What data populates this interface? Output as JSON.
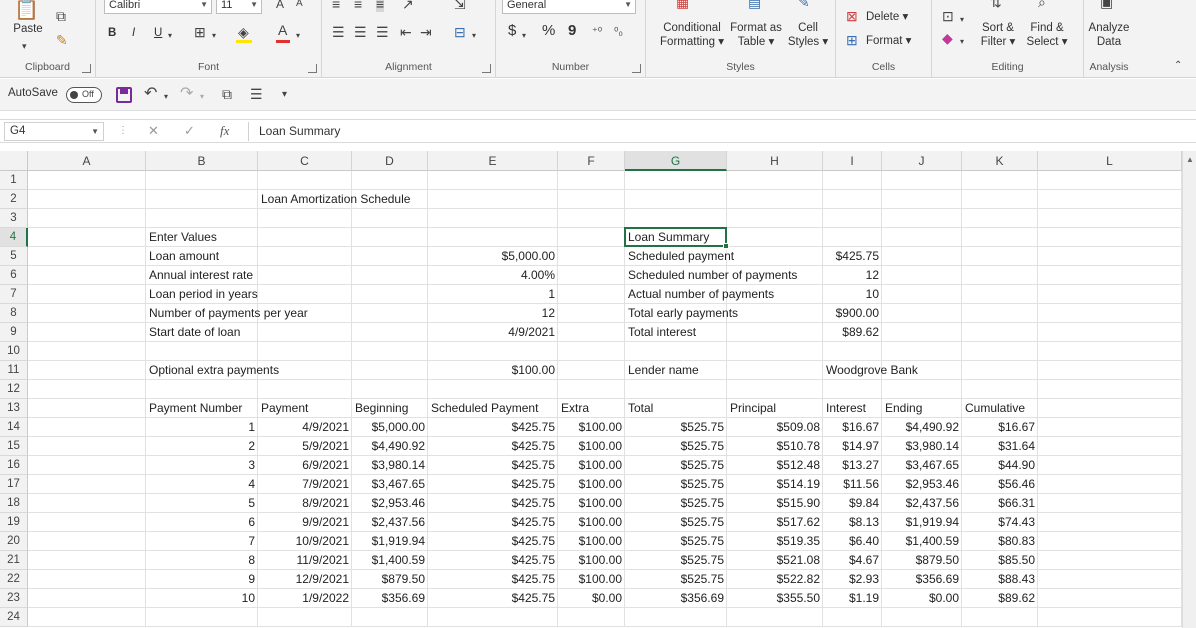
{
  "ribbon": {
    "clipboard": {
      "label": "Clipboard",
      "paste": "Paste"
    },
    "font": {
      "label": "Font",
      "name": "Calibri",
      "size": "11",
      "bold": "B",
      "italic": "I",
      "underline": "U"
    },
    "alignment": {
      "label": "Alignment"
    },
    "number": {
      "label": "Number",
      "format": "General",
      "currency": "$",
      "percent": "%",
      "comma": "9"
    },
    "styles": {
      "label": "Styles",
      "conditional": "Conditional",
      "conditional2": "Formatting",
      "format_table": "Format as",
      "format_table2": "Table",
      "cell_styles": "Cell",
      "cell_styles2": "Styles"
    },
    "cells": {
      "label": "Cells",
      "delete": "Delete",
      "format": "Format"
    },
    "editing": {
      "label": "Editing",
      "sort": "Sort &",
      "sort2": "Filter",
      "find": "Find &",
      "find2": "Select"
    },
    "analysis": {
      "label": "Analysis",
      "analyze": "Analyze",
      "analyze2": "Data"
    }
  },
  "qat": {
    "autosave": "AutoSave",
    "autosave_state": "Off"
  },
  "formula_bar": {
    "name_box": "G4",
    "cancel": "✕",
    "enter": "✓",
    "fx": "fx",
    "content": "Loan Summary"
  },
  "grid": {
    "columns": [
      "A",
      "B",
      "C",
      "D",
      "E",
      "F",
      "G",
      "H",
      "I",
      "J",
      "K",
      "L"
    ],
    "selected_column": "G",
    "rows": [
      "1",
      "2",
      "3",
      "4",
      "5",
      "6",
      "7",
      "8",
      "9",
      "10",
      "11",
      "12",
      "13",
      "14",
      "15",
      "16",
      "17",
      "18",
      "19",
      "20",
      "21",
      "22",
      "23",
      "24"
    ],
    "selected_row": "4",
    "title": "Loan Amortization Schedule",
    "enter_values": "Enter Values",
    "inputs": [
      {
        "label": "Loan amount",
        "value": "$5,000.00"
      },
      {
        "label": "Annual interest rate",
        "value": "4.00%"
      },
      {
        "label": "Loan period in years",
        "value": "1"
      },
      {
        "label": "Number of payments per year",
        "value": "12"
      },
      {
        "label": "Start date of loan",
        "value": "4/9/2021"
      }
    ],
    "extra_label": "Optional extra payments",
    "extra_value": "$100.00",
    "summary_title": "Loan Summary",
    "summary": [
      {
        "label": "Scheduled payment",
        "value": "$425.75"
      },
      {
        "label": "Scheduled number of payments",
        "value": "12"
      },
      {
        "label": "Actual number of payments",
        "value": "10"
      },
      {
        "label": "Total early payments",
        "value": "$900.00"
      },
      {
        "label": "Total interest",
        "value": "$89.62"
      }
    ],
    "lender_label": "Lender name",
    "lender_value": "Woodgrove Bank",
    "table_headers": [
      "Payment Number",
      "Payment",
      "Beginning",
      "Scheduled Payment",
      "Extra",
      "Total",
      "Principal",
      "Interest",
      "Ending",
      "Cumulative"
    ],
    "table_rows": [
      [
        "1",
        "4/9/2021",
        "$5,000.00",
        "$425.75",
        "$100.00",
        "$525.75",
        "$509.08",
        "$16.67",
        "$4,490.92",
        "$16.67"
      ],
      [
        "2",
        "5/9/2021",
        "$4,490.92",
        "$425.75",
        "$100.00",
        "$525.75",
        "$510.78",
        "$14.97",
        "$3,980.14",
        "$31.64"
      ],
      [
        "3",
        "6/9/2021",
        "$3,980.14",
        "$425.75",
        "$100.00",
        "$525.75",
        "$512.48",
        "$13.27",
        "$3,467.65",
        "$44.90"
      ],
      [
        "4",
        "7/9/2021",
        "$3,467.65",
        "$425.75",
        "$100.00",
        "$525.75",
        "$514.19",
        "$11.56",
        "$2,953.46",
        "$56.46"
      ],
      [
        "5",
        "8/9/2021",
        "$2,953.46",
        "$425.75",
        "$100.00",
        "$525.75",
        "$515.90",
        "$9.84",
        "$2,437.56",
        "$66.31"
      ],
      [
        "6",
        "9/9/2021",
        "$2,437.56",
        "$425.75",
        "$100.00",
        "$525.75",
        "$517.62",
        "$8.13",
        "$1,919.94",
        "$74.43"
      ],
      [
        "7",
        "10/9/2021",
        "$1,919.94",
        "$425.75",
        "$100.00",
        "$525.75",
        "$519.35",
        "$6.40",
        "$1,400.59",
        "$80.83"
      ],
      [
        "8",
        "11/9/2021",
        "$1,400.59",
        "$425.75",
        "$100.00",
        "$525.75",
        "$521.08",
        "$4.67",
        "$879.50",
        "$85.50"
      ],
      [
        "9",
        "12/9/2021",
        "$879.50",
        "$425.75",
        "$100.00",
        "$525.75",
        "$522.82",
        "$2.93",
        "$356.69",
        "$88.43"
      ],
      [
        "10",
        "1/9/2022",
        "$356.69",
        "$425.75",
        "$0.00",
        "$356.69",
        "$355.50",
        "$1.19",
        "$0.00",
        "$89.62"
      ]
    ]
  },
  "colors": {
    "accent": "#217346",
    "save_icon": "#7b2a9c",
    "font_color_bar": "#e03030",
    "fill_color_bar": "#ffe600"
  }
}
